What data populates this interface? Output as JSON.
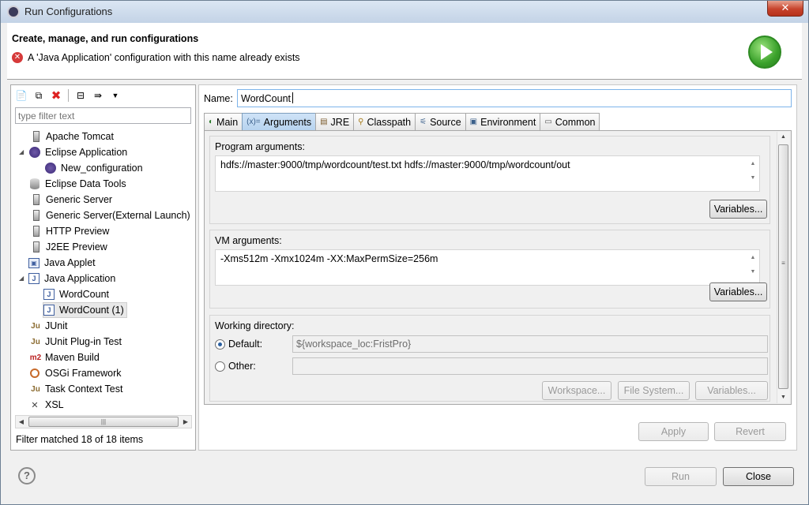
{
  "window": {
    "title": "Run Configurations",
    "close_glyph": "✕"
  },
  "header": {
    "title": "Create, manage, and run configurations",
    "error_message": "A 'Java Application' configuration with this name already exists",
    "error_icon": "error-icon",
    "run_icon": "run-icon"
  },
  "sidebar": {
    "toolbar_icons": [
      "new-config-icon",
      "duplicate-icon",
      "delete-icon",
      "collapse-all-icon",
      "filter-icon",
      "dropdown-icon"
    ],
    "filter_placeholder": "type filter text",
    "items": [
      {
        "label": "Apache Tomcat",
        "icon": "tomcat-icon"
      },
      {
        "label": "Eclipse Application",
        "icon": "eclipse-icon",
        "expanded": true
      },
      {
        "label": "New_configuration",
        "icon": "eclipse-icon"
      },
      {
        "label": "Eclipse Data Tools",
        "icon": "database-icon"
      },
      {
        "label": "Generic Server",
        "icon": "server-icon"
      },
      {
        "label": "Generic Server(External Launch)",
        "icon": "server-icon"
      },
      {
        "label": "HTTP Preview",
        "icon": "server-icon"
      },
      {
        "label": "J2EE Preview",
        "icon": "server-icon"
      },
      {
        "label": "Java Applet",
        "icon": "applet-icon"
      },
      {
        "label": "Java Application",
        "icon": "java-app-icon",
        "expanded": true
      },
      {
        "label": "WordCount",
        "icon": "java-app-icon"
      },
      {
        "label": "WordCount (1)",
        "icon": "java-app-icon",
        "selected": true
      },
      {
        "label": "JUnit",
        "icon": "junit-icon",
        "icon_text": "Ju"
      },
      {
        "label": "JUnit Plug-in Test",
        "icon": "junit-plugin-icon",
        "icon_text": "Ju"
      },
      {
        "label": "Maven Build",
        "icon": "maven-icon",
        "icon_text": "m2"
      },
      {
        "label": "OSGi Framework",
        "icon": "osgi-icon"
      },
      {
        "label": "Task Context Test",
        "icon": "task-context-icon",
        "icon_text": "Ju"
      },
      {
        "label": "XSL",
        "icon": "xsl-icon",
        "icon_text": "✕"
      }
    ],
    "status": "Filter matched 18 of 18 items"
  },
  "config": {
    "name_label": "Name:",
    "name_value": "WordCount",
    "tabs": [
      {
        "label": "Main",
        "icon": "main-tab-icon",
        "glyph": "◐"
      },
      {
        "label": "Arguments",
        "icon": "arguments-tab-icon",
        "glyph": "(x)=",
        "active": true
      },
      {
        "label": "JRE",
        "icon": "jre-tab-icon",
        "glyph": "▤"
      },
      {
        "label": "Classpath",
        "icon": "classpath-tab-icon",
        "glyph": "⚲"
      },
      {
        "label": "Source",
        "icon": "source-tab-icon",
        "glyph": "⚟"
      },
      {
        "label": "Environment",
        "icon": "environment-tab-icon",
        "glyph": "▣"
      },
      {
        "label": "Common",
        "icon": "common-tab-icon",
        "glyph": "▭"
      }
    ],
    "program_args": {
      "label": "Program arguments:",
      "value": "hdfs://master:9000/tmp/wordcount/test.txt hdfs://master:9000/tmp/wordcount/out",
      "variables_button": "Variables..."
    },
    "vm_args": {
      "label": "VM arguments:",
      "value": "-Xms512m -Xmx1024m -XX:MaxPermSize=256m",
      "variables_button": "Variables..."
    },
    "working_dir": {
      "label": "Working directory:",
      "default_label": "Default:",
      "default_value": "${workspace_loc:FristPro}",
      "other_label": "Other:",
      "other_value": "",
      "selected": "Default",
      "workspace_button": "Workspace...",
      "filesystem_button": "File System...",
      "variables_button": "Variables..."
    },
    "apply_button": "Apply",
    "revert_button": "Revert"
  },
  "footer": {
    "run_button": "Run",
    "close_button": "Close",
    "help_glyph": "?"
  }
}
